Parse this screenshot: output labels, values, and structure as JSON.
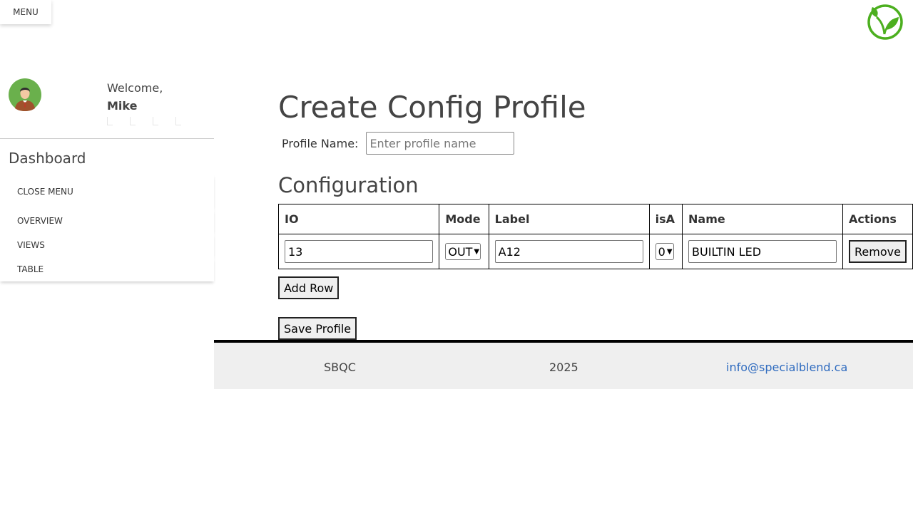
{
  "top": {
    "menu_label": "MENU"
  },
  "sidebar": {
    "welcome_text": "Welcome,",
    "user_name": "Mike",
    "dashboard_title": "Dashboard",
    "close_menu_label": "CLOSE MENU",
    "items": [
      {
        "label": "OVERVIEW"
      },
      {
        "label": "VIEWS"
      },
      {
        "label": "TABLE"
      }
    ]
  },
  "main": {
    "title": "Create Config Profile",
    "profile_label": "Profile Name:",
    "profile_placeholder": "Enter profile name",
    "profile_value": "",
    "config_title": "Configuration",
    "table": {
      "headers": [
        "IO",
        "Mode",
        "Label",
        "isA",
        "Name",
        "Actions"
      ],
      "rows": [
        {
          "io": "13",
          "mode": "OUT",
          "label": "A12",
          "isA": "0",
          "name": "BUILTIN LED",
          "action": "Remove"
        }
      ]
    },
    "add_row_label": "Add Row",
    "save_label": "Save Profile"
  },
  "footer": {
    "org": "SBQC",
    "year": "2025",
    "email": "info@specialblend.ca"
  },
  "colors": {
    "link": "#2f6bbf",
    "logo_green": "#4caf1f",
    "footer_bg": "#efefef"
  },
  "icons": {
    "logo": "leaf-logo-icon",
    "avatar": "user-avatar-icon"
  }
}
